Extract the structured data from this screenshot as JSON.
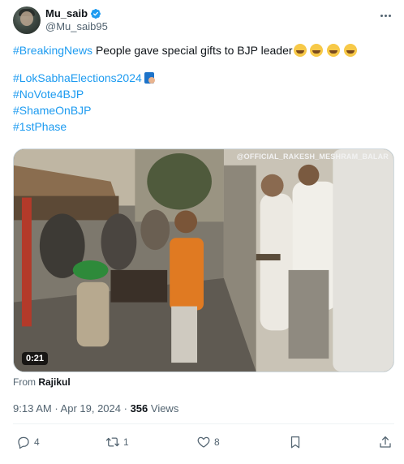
{
  "author": {
    "display_name": "Mu_saib",
    "handle": "@Mu_saib95"
  },
  "tweet": {
    "line1_hashtag": "#BreakingNews",
    "line1_text": " People gave special gifts to BJP leader",
    "hashtags": [
      "#LokSabhaElections2024",
      "#NoVote4BJP",
      "#ShameOnBJP",
      "#1stPhase"
    ]
  },
  "media": {
    "watermark": "@OFFICIAL_RAKESH_MESHRAM_BALAR",
    "duration": "0:21"
  },
  "source": {
    "prefix": "From ",
    "name": "Rajikul"
  },
  "meta": {
    "time": "9:13 AM",
    "separator": " · ",
    "date": "Apr 19, 2024",
    "views_count": "356",
    "views_label": " Views"
  },
  "actions": {
    "reply_count": "4",
    "retweet_count": "1",
    "like_count": "8"
  },
  "colors": {
    "accent": "#1d9bf0",
    "text_primary": "#0f1419",
    "text_secondary": "#536471"
  }
}
